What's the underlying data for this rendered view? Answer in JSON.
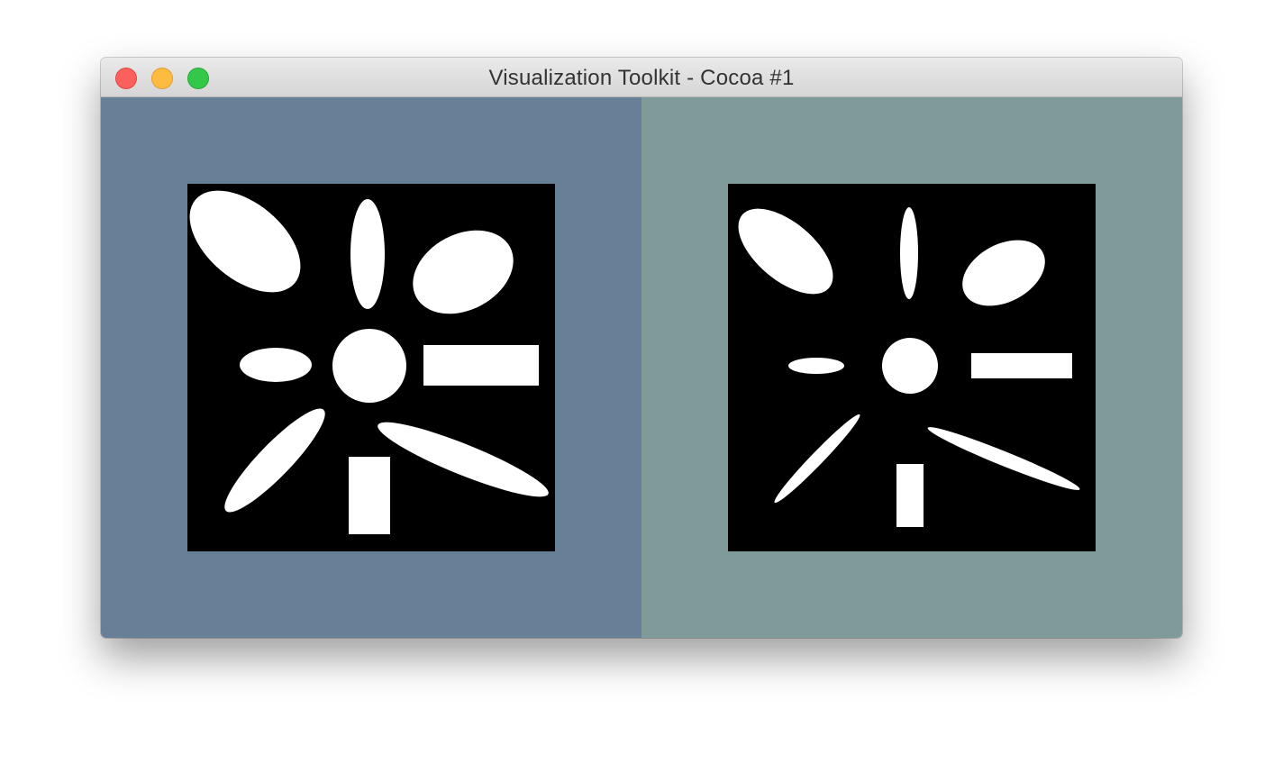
{
  "window": {
    "title": "Visualization Toolkit - Cocoa #1",
    "controls": {
      "close_icon": "close-icon",
      "minimize_icon": "minimize-icon",
      "zoom_icon": "zoom-icon"
    }
  },
  "viewports": [
    {
      "id": "left",
      "background": "#678098",
      "content": "binary-image-original"
    },
    {
      "id": "right",
      "background": "#809a9a",
      "content": "binary-image-eroded"
    }
  ],
  "colors": {
    "image_background": "#000000",
    "shape_fill": "#ffffff"
  }
}
